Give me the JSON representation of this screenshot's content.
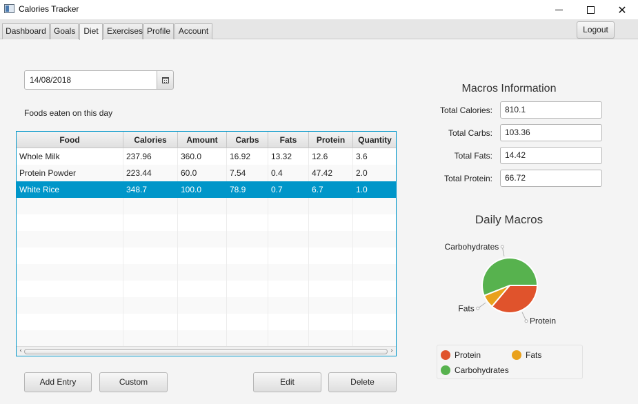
{
  "window": {
    "title": "Calories Tracker"
  },
  "tabs": [
    {
      "label": "Dashboard",
      "active": false
    },
    {
      "label": "Goals",
      "active": false
    },
    {
      "label": "Diet",
      "active": true
    },
    {
      "label": "Exercises",
      "active": false
    },
    {
      "label": "Profile",
      "active": false
    },
    {
      "label": "Account",
      "active": false
    }
  ],
  "header": {
    "logout_label": "Logout"
  },
  "diet": {
    "date_value": "14/08/2018",
    "foods_label": "Foods eaten on this day",
    "table": {
      "columns": [
        "Food",
        "Calories",
        "Amount",
        "Carbs",
        "Fats",
        "Protein",
        "Quantity"
      ],
      "rows": [
        {
          "food": "Whole Milk",
          "calories": "237.96",
          "amount": "360.0",
          "carbs": "16.92",
          "fats": "13.32",
          "protein": "12.6",
          "quantity": "3.6",
          "selected": false
        },
        {
          "food": "Protein Powder",
          "calories": "223.44",
          "amount": "60.0",
          "carbs": "7.54",
          "fats": "0.4",
          "protein": "47.42",
          "quantity": "2.0",
          "selected": false
        },
        {
          "food": "White Rice",
          "calories": "348.7",
          "amount": "100.0",
          "carbs": "78.9",
          "fats": "0.7",
          "protein": "6.7",
          "quantity": "1.0",
          "selected": true
        }
      ]
    },
    "buttons": {
      "add_entry": "Add Entry",
      "custom": "Custom",
      "edit": "Edit",
      "delete": "Delete"
    }
  },
  "macros": {
    "title": "Macros Information",
    "total_calories_label": "Total Calories:",
    "total_calories": "810.1",
    "total_carbs_label": "Total Carbs:",
    "total_carbs": "103.36",
    "total_fats_label": "Total Fats:",
    "total_fats": "14.42",
    "total_protein_label": "Total Protein:",
    "total_protein": "66.72"
  },
  "colors": {
    "selection": "#0096c9",
    "protein": "#e0532c",
    "fats": "#e9a11c",
    "carbohydrates": "#57b24e"
  },
  "chart_data": {
    "type": "pie",
    "title": "Daily Macros",
    "labels": [
      "Protein",
      "Fats",
      "Carbohydrates"
    ],
    "values": [
      66.72,
      14.42,
      103.36
    ],
    "legend": "bottom"
  }
}
